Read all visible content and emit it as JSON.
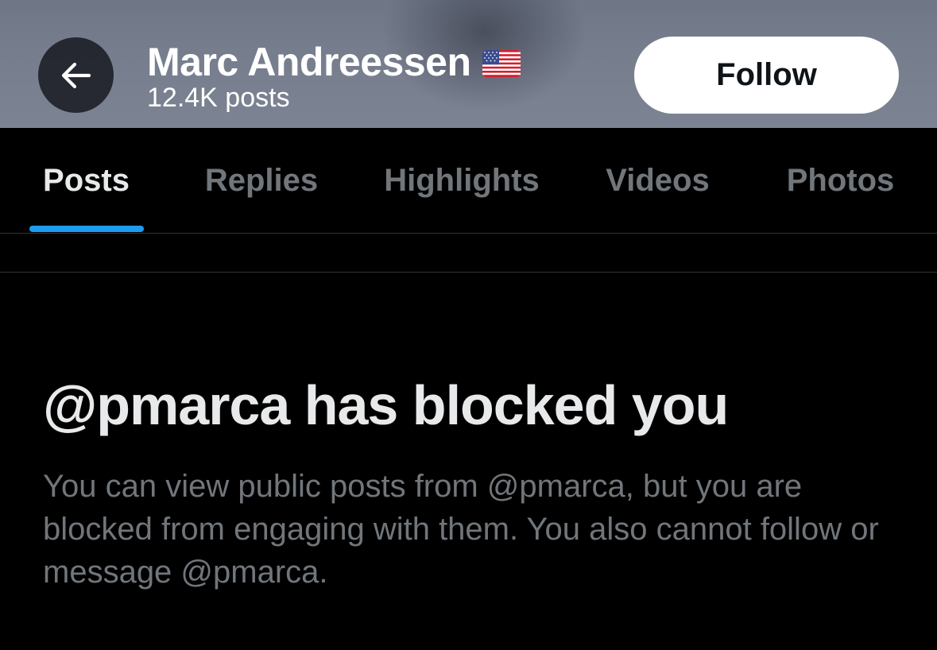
{
  "header": {
    "back_icon": "arrow-left-icon",
    "name": "Marc Andreessen",
    "flag_icon": "us-flag-icon",
    "post_count": "12.4K posts",
    "follow_label": "Follow"
  },
  "tabs": [
    {
      "label": "Posts",
      "active": true
    },
    {
      "label": "Replies",
      "active": false
    },
    {
      "label": "Highlights",
      "active": false
    },
    {
      "label": "Videos",
      "active": false
    },
    {
      "label": "Photos",
      "active": false
    }
  ],
  "blocked": {
    "title": "@pmarca has blocked you",
    "body": "You can view public posts from @pmarca, but you are blocked from engaging with them. You also cannot follow or message @pmarca."
  },
  "colors": {
    "accent": "#1d9bf0",
    "background": "#000000",
    "primary_text": "#e7e9ea",
    "secondary_text": "#71767b"
  }
}
